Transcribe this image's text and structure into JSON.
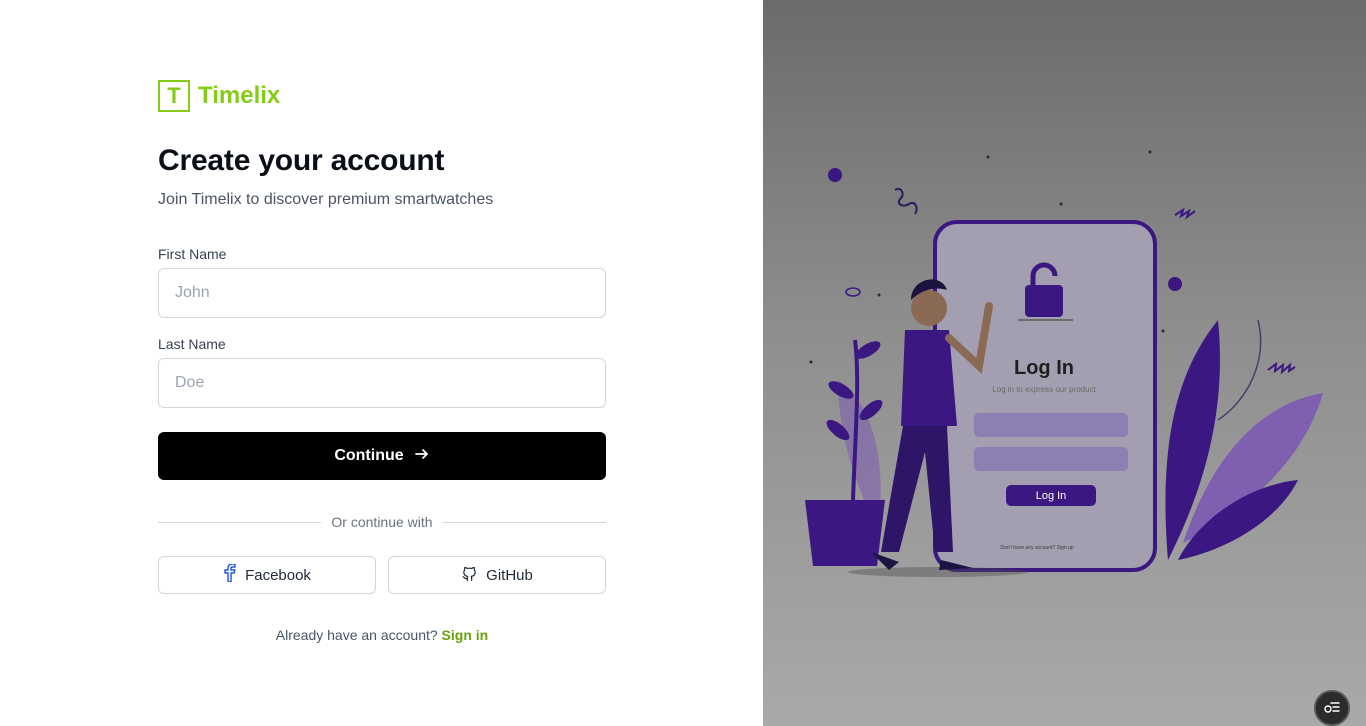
{
  "brand": {
    "logo_letter": "T",
    "name": "Timelix",
    "accent_color": "#84cc16"
  },
  "form": {
    "title": "Create your account",
    "subtitle": "Join Timelix to discover premium smartwatches",
    "first_name": {
      "label": "First Name",
      "placeholder": "John",
      "value": ""
    },
    "last_name": {
      "label": "Last Name",
      "placeholder": "Doe",
      "value": ""
    },
    "continue_label": "Continue",
    "divider_text": "Or continue with",
    "social": {
      "facebook_label": "Facebook",
      "github_label": "GitHub"
    },
    "signin_prompt": "Already have an account?",
    "signin_link": "Sign in"
  },
  "illustration": {
    "heading": "Log In",
    "caption": "Log in to express our product",
    "button_label": "Log In",
    "footer_text": "Don't have any account? Sign up"
  },
  "icons": {
    "continue": "arrow-right-icon",
    "facebook": "facebook-icon",
    "github": "github-icon",
    "fab": "menu-icon"
  }
}
